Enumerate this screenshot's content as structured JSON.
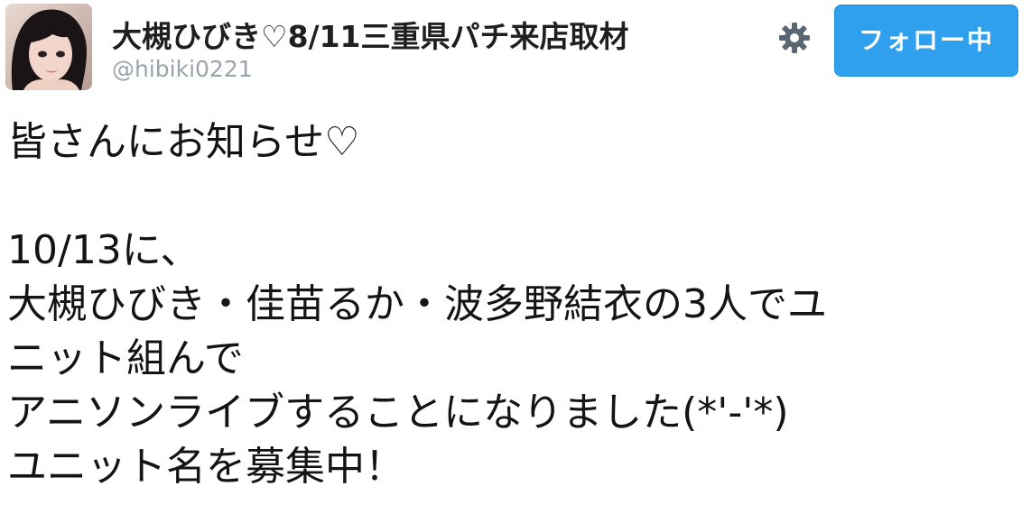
{
  "header": {
    "display_name": "大槻ひびき♡8/11三重県パチ来店取材",
    "handle": "@hibiki0221",
    "settings_icon": "gear-icon",
    "follow_button_label": "フォロー中",
    "colors": {
      "follow_button": "#2fa0ee",
      "handle": "#9aa3ab"
    }
  },
  "tweet": {
    "lines": [
      "皆さんにお知らせ♡",
      "",
      "10/13に、",
      "大槻ひびき・佳苗るか・波多野結衣の3人でユ",
      "ニット組んで",
      "アニソンライブすることになりました(*'-'*)",
      "ユニット名を募集中！"
    ]
  }
}
